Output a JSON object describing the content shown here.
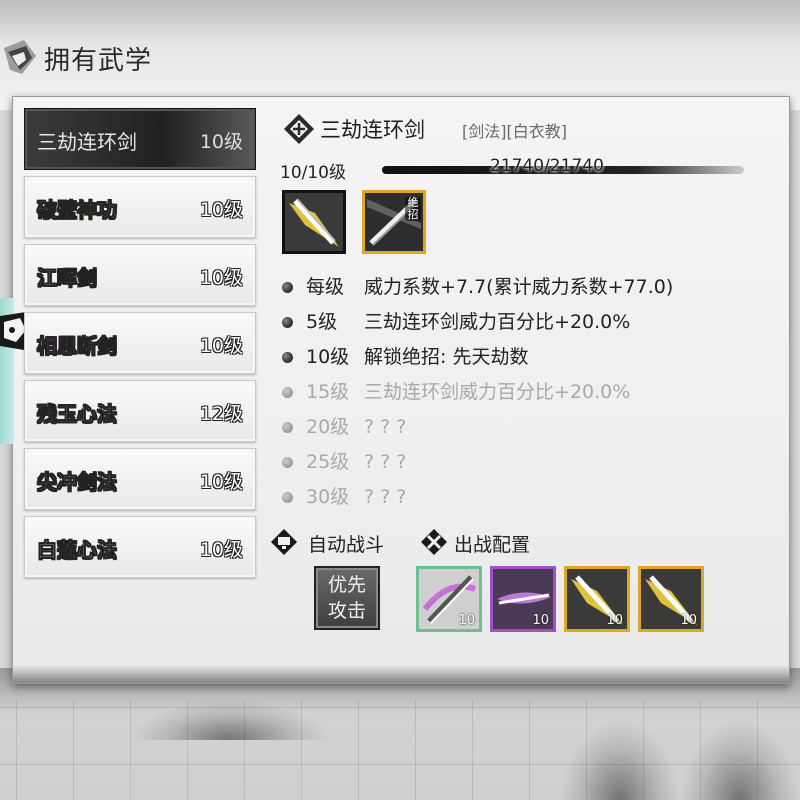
{
  "header": {
    "title": "拥有武学"
  },
  "skills": [
    {
      "name": "三劫连环剑",
      "level": "10级",
      "color": "#e8e8e8"
    },
    {
      "name": "破壁神功",
      "level": "10级",
      "color": "#f3a33a"
    },
    {
      "name": "江晖剑",
      "level": "10级",
      "color": "#f3a33a"
    },
    {
      "name": "相思断剑",
      "level": "10级",
      "color": "#c070d8"
    },
    {
      "name": "残玉心法",
      "level": "12级",
      "color": "#8ecfe0"
    },
    {
      "name": "尖冲剑法",
      "level": "10级",
      "color": "#7fd98a"
    },
    {
      "name": "白莲心法",
      "level": "10级",
      "color": "#ffffff"
    }
  ],
  "detail": {
    "name": "三劫连环剑",
    "tags": "[剑法][白衣教]",
    "level": "10/10级",
    "exp": "21740/21740",
    "exp_fraction": 1.0,
    "slot_badge": "绝招",
    "effects": [
      {
        "level": "每级",
        "text": "威力系数+7.7(累计威力系数+77.0)",
        "unlocked": true
      },
      {
        "level": "5级",
        "text": "三劫连环剑威力百分比+20.0%",
        "unlocked": true
      },
      {
        "level": "10级",
        "text": "解锁绝招:  先天劫数",
        "unlocked": true
      },
      {
        "level": "15级",
        "text": "三劫连环剑威力百分比+20.0%",
        "unlocked": false
      },
      {
        "level": "20级",
        "text": "? ? ?",
        "unlocked": false
      },
      {
        "level": "25级",
        "text": "? ? ?",
        "unlocked": false
      },
      {
        "level": "30级",
        "text": "? ? ?",
        "unlocked": false
      }
    ]
  },
  "auto_battle": {
    "label": "自动战斗",
    "priority_line1": "优先",
    "priority_line2": "攻击"
  },
  "battle_config": {
    "label": "出战配置",
    "slots": [
      {
        "level": "10",
        "border": "green"
      },
      {
        "level": "10",
        "border": "purple"
      },
      {
        "level": "10",
        "border": "gold"
      },
      {
        "level": "10",
        "border": "gold"
      }
    ]
  }
}
